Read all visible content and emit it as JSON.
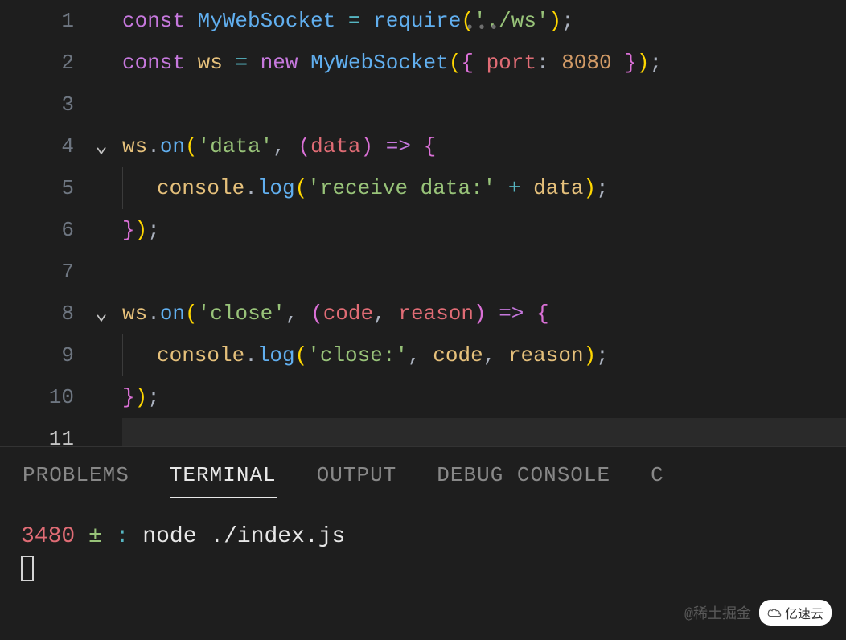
{
  "editor": {
    "lines": {
      "1": {
        "tokens": [
          {
            "t": "const ",
            "c": "kw"
          },
          {
            "t": "MyWebSocket",
            "c": "cls"
          },
          {
            "t": " ",
            "c": "punc"
          },
          {
            "t": "=",
            "c": "op"
          },
          {
            "t": " ",
            "c": "punc"
          },
          {
            "t": "require",
            "c": "fn"
          },
          {
            "t": "(",
            "c": "brace"
          },
          {
            "t": "'./ws'",
            "c": "str"
          },
          {
            "t": ")",
            "c": "brace"
          },
          {
            "t": ";",
            "c": "semi"
          }
        ]
      },
      "2": {
        "tokens": [
          {
            "t": "const ",
            "c": "kw"
          },
          {
            "t": "ws",
            "c": "var"
          },
          {
            "t": " ",
            "c": "punc"
          },
          {
            "t": "=",
            "c": "op"
          },
          {
            "t": " ",
            "c": "punc"
          },
          {
            "t": "new ",
            "c": "kw"
          },
          {
            "t": "MyWebSocket",
            "c": "cls"
          },
          {
            "t": "(",
            "c": "brace"
          },
          {
            "t": "{ ",
            "c": "brace2"
          },
          {
            "t": "port",
            "c": "prop"
          },
          {
            "t": ":",
            "c": "punc"
          },
          {
            "t": " ",
            "c": "punc"
          },
          {
            "t": "8080",
            "c": "num"
          },
          {
            "t": " }",
            "c": "brace2"
          },
          {
            "t": ")",
            "c": "brace"
          },
          {
            "t": ";",
            "c": "semi"
          }
        ]
      },
      "3": {
        "tokens": []
      },
      "4": {
        "fold": true,
        "tokens": [
          {
            "t": "ws",
            "c": "var"
          },
          {
            "t": ".",
            "c": "punc"
          },
          {
            "t": "on",
            "c": "fn"
          },
          {
            "t": "(",
            "c": "brace"
          },
          {
            "t": "'data'",
            "c": "str"
          },
          {
            "t": ", ",
            "c": "punc"
          },
          {
            "t": "(",
            "c": "brace2"
          },
          {
            "t": "data",
            "c": "param"
          },
          {
            "t": ")",
            "c": "brace2"
          },
          {
            "t": " ",
            "c": "punc"
          },
          {
            "t": "=>",
            "c": "kw"
          },
          {
            "t": " ",
            "c": "punc"
          },
          {
            "t": "{",
            "c": "brace2"
          }
        ]
      },
      "5": {
        "guide": true,
        "tokens": [
          {
            "t": "console",
            "c": "var"
          },
          {
            "t": ".",
            "c": "punc"
          },
          {
            "t": "log",
            "c": "fn"
          },
          {
            "t": "(",
            "c": "brace"
          },
          {
            "t": "'receive data:'",
            "c": "str"
          },
          {
            "t": " ",
            "c": "punc"
          },
          {
            "t": "+",
            "c": "plus"
          },
          {
            "t": " ",
            "c": "punc"
          },
          {
            "t": "data",
            "c": "var"
          },
          {
            "t": ")",
            "c": "brace"
          },
          {
            "t": ";",
            "c": "semi"
          }
        ]
      },
      "6": {
        "tokens": [
          {
            "t": "}",
            "c": "brace2"
          },
          {
            "t": ")",
            "c": "brace"
          },
          {
            "t": ";",
            "c": "semi"
          }
        ]
      },
      "7": {
        "tokens": []
      },
      "8": {
        "fold": true,
        "tokens": [
          {
            "t": "ws",
            "c": "var"
          },
          {
            "t": ".",
            "c": "punc"
          },
          {
            "t": "on",
            "c": "fn"
          },
          {
            "t": "(",
            "c": "brace"
          },
          {
            "t": "'close'",
            "c": "str"
          },
          {
            "t": ", ",
            "c": "punc"
          },
          {
            "t": "(",
            "c": "brace2"
          },
          {
            "t": "code",
            "c": "param"
          },
          {
            "t": ", ",
            "c": "punc"
          },
          {
            "t": "reason",
            "c": "param"
          },
          {
            "t": ")",
            "c": "brace2"
          },
          {
            "t": " ",
            "c": "punc"
          },
          {
            "t": "=>",
            "c": "kw"
          },
          {
            "t": " ",
            "c": "punc"
          },
          {
            "t": "{",
            "c": "brace2"
          }
        ]
      },
      "9": {
        "guide": true,
        "tokens": [
          {
            "t": "console",
            "c": "var"
          },
          {
            "t": ".",
            "c": "punc"
          },
          {
            "t": "log",
            "c": "fn"
          },
          {
            "t": "(",
            "c": "brace"
          },
          {
            "t": "'close:'",
            "c": "str"
          },
          {
            "t": ", ",
            "c": "punc"
          },
          {
            "t": "code",
            "c": "var"
          },
          {
            "t": ", ",
            "c": "punc"
          },
          {
            "t": "reason",
            "c": "var"
          },
          {
            "t": ")",
            "c": "brace"
          },
          {
            "t": ";",
            "c": "semi"
          }
        ]
      },
      "10": {
        "tokens": [
          {
            "t": "}",
            "c": "brace2"
          },
          {
            "t": ")",
            "c": "brace"
          },
          {
            "t": ";",
            "c": "semi"
          }
        ]
      },
      "11": {
        "tokens": [],
        "current": true
      }
    },
    "hint_dots": "•••"
  },
  "panel": {
    "tabs": [
      {
        "label": "PROBLEMS",
        "active": false
      },
      {
        "label": "TERMINAL",
        "active": true
      },
      {
        "label": "OUTPUT",
        "active": false
      },
      {
        "label": "DEBUG CONSOLE",
        "active": false
      }
    ],
    "extra_tab_char": "C"
  },
  "terminal": {
    "pid": "3480",
    "pm": "±",
    "colon": ":",
    "command": "node ./index.js"
  },
  "watermark": {
    "text": "@稀土掘金",
    "badge": "亿速云"
  }
}
